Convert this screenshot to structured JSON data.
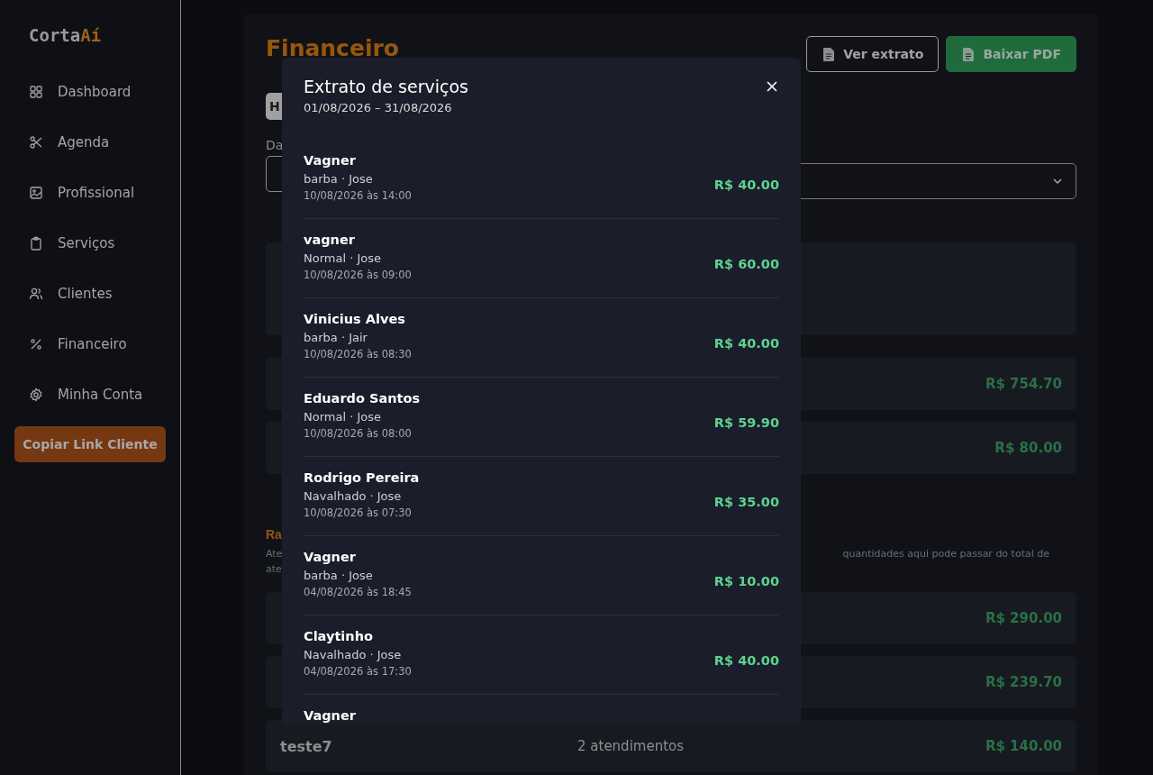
{
  "brand": {
    "name": "Corta",
    "accent": "Aí"
  },
  "nav": [
    {
      "label": "Dashboard"
    },
    {
      "label": "Agenda"
    },
    {
      "label": "Profissional"
    },
    {
      "label": "Serviços"
    },
    {
      "label": "Clientes"
    },
    {
      "label": "Financeiro"
    },
    {
      "label": "Minha Conta"
    }
  ],
  "copy_button": "Copiar Link Cliente",
  "page": {
    "title": "Financeiro",
    "buttons": [
      {
        "label": "Ver extrato",
        "kind": "outline"
      },
      {
        "label": "Baixar PDF",
        "kind": "primary"
      }
    ],
    "tab_fragment": "H",
    "label_fragment": "Da",
    "summary_rows": [
      {
        "amount": "R$ 754.70"
      },
      {
        "amount": "R$ 80.00"
      }
    ],
    "ranking": {
      "title_fragment": "Ra",
      "note_fragments": [
        "Ate",
        "quantidades aqui pode passar do total de",
        "ate"
      ],
      "rows": [
        {
          "amount": "R$ 290.00"
        },
        {
          "amount": "R$ 239.70"
        },
        {
          "name": "teste7",
          "count": "2 atendimentos",
          "amount": "R$ 140.00"
        }
      ]
    }
  },
  "modal": {
    "title": "Extrato de serviços",
    "period": "01/08/2026 – 31/08/2026",
    "entries": [
      {
        "client": "Vagner",
        "service": "barba · Jose",
        "date": "10/08/2026 às 14:00",
        "amount": "R$ 40.00"
      },
      {
        "client": "vagner",
        "service": "Normal · Jose",
        "date": "10/08/2026 às 09:00",
        "amount": "R$ 60.00"
      },
      {
        "client": "Vinicius Alves",
        "service": "barba · Jair",
        "date": "10/08/2026 às 08:30",
        "amount": "R$ 40.00"
      },
      {
        "client": "Eduardo Santos",
        "service": "Normal · Jose",
        "date": "10/08/2026 às 08:00",
        "amount": "R$ 59.90"
      },
      {
        "client": "Rodrigo Pereira",
        "service": "Navalhado · Jose",
        "date": "10/08/2026 às 07:30",
        "amount": "R$ 35.00"
      },
      {
        "client": "Vagner",
        "service": "barba · Jose",
        "date": "04/08/2026 às 18:45",
        "amount": "R$ 10.00"
      },
      {
        "client": "Claytinho",
        "service": "Navalhado · Jose",
        "date": "04/08/2026 às 17:30",
        "amount": "R$ 40.00"
      },
      {
        "client": "Vagner"
      }
    ]
  }
}
